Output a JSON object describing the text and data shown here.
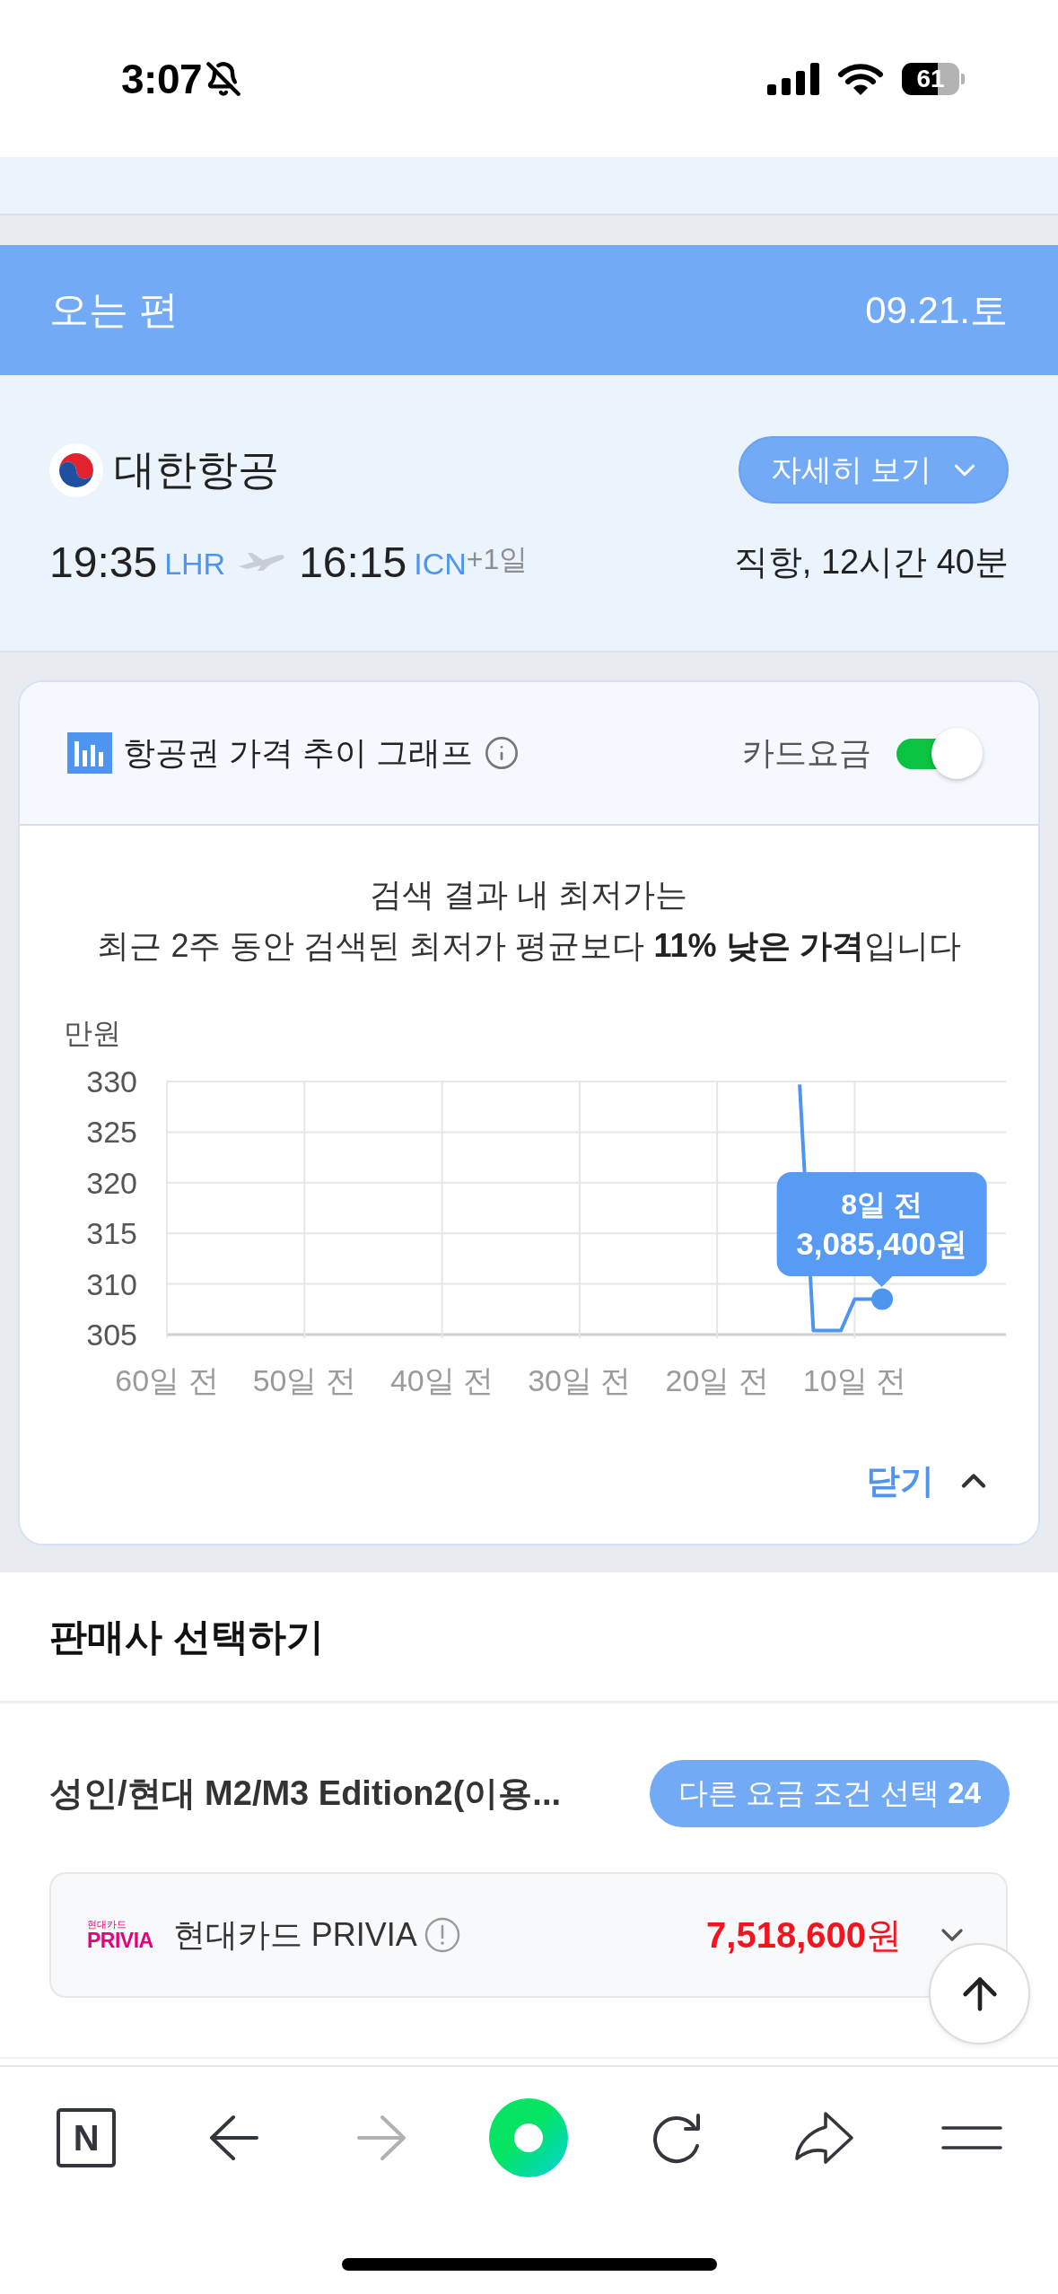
{
  "status_bar": {
    "time": "3:07",
    "battery": "61"
  },
  "return_flight": {
    "heading": "오는 편",
    "date": "09.21.토"
  },
  "flight": {
    "airline": "대한항공",
    "details_button": "자세히 보기",
    "departure": {
      "time": "19:35",
      "airport": "LHR"
    },
    "arrival": {
      "time": "16:15",
      "airport": "ICN",
      "day_offset": "+1일"
    },
    "summary": "직항, 12시간 40분"
  },
  "price_trend": {
    "title": "항공권 가격 추이 그래프",
    "card_fare": {
      "label": "카드요금",
      "on": true
    },
    "message": [
      "검색 결과 내 최저가는",
      "최근 2주 동안 검색된 최저가 평균보다 **11% 낮은 가격**입니다"
    ],
    "chart_data": {
      "type": "line",
      "ylabel": "만원",
      "x": [
        14,
        13,
        11,
        10,
        8
      ],
      "series": [
        {
          "color": "#4f95ef",
          "values": [
            329.7,
            305.4,
            305.4,
            308.5,
            308.5
          ]
        }
      ],
      "xlim": [
        60,
        -1
      ],
      "ylim": [
        305,
        330
      ],
      "xticks": [
        {
          "value": 60,
          "label": "60일 전"
        },
        {
          "value": 50,
          "label": "50일 전"
        },
        {
          "value": 40,
          "label": "40일 전"
        },
        {
          "value": 30,
          "label": "30일 전"
        },
        {
          "value": 20,
          "label": "20일 전"
        },
        {
          "value": 10,
          "label": "10일 전"
        }
      ],
      "yticks": [
        305,
        310,
        315,
        320,
        325,
        330
      ],
      "grid": true
    },
    "tooltip": {
      "date": "8일 전",
      "price": "3,085,400원"
    },
    "close_button": "닫기"
  },
  "sellers": {
    "title": "판매사 선택하기",
    "fare_condition": "성인/현대 M2/M3 Edition2(이용...",
    "other_conditions_button": "다른 요금 조건 선택 **24**",
    "offers": [
      {
        "logo_caption": "현대카드",
        "logo": "PRIVIA",
        "name": "현대카드 PRIVIA",
        "price": "**7,518,600**원",
        "expanded": false
      }
    ]
  },
  "browser_toolbar": {
    "home_label": "N",
    "back": {
      "disabled": false
    },
    "forward": {
      "disabled": true
    }
  }
}
